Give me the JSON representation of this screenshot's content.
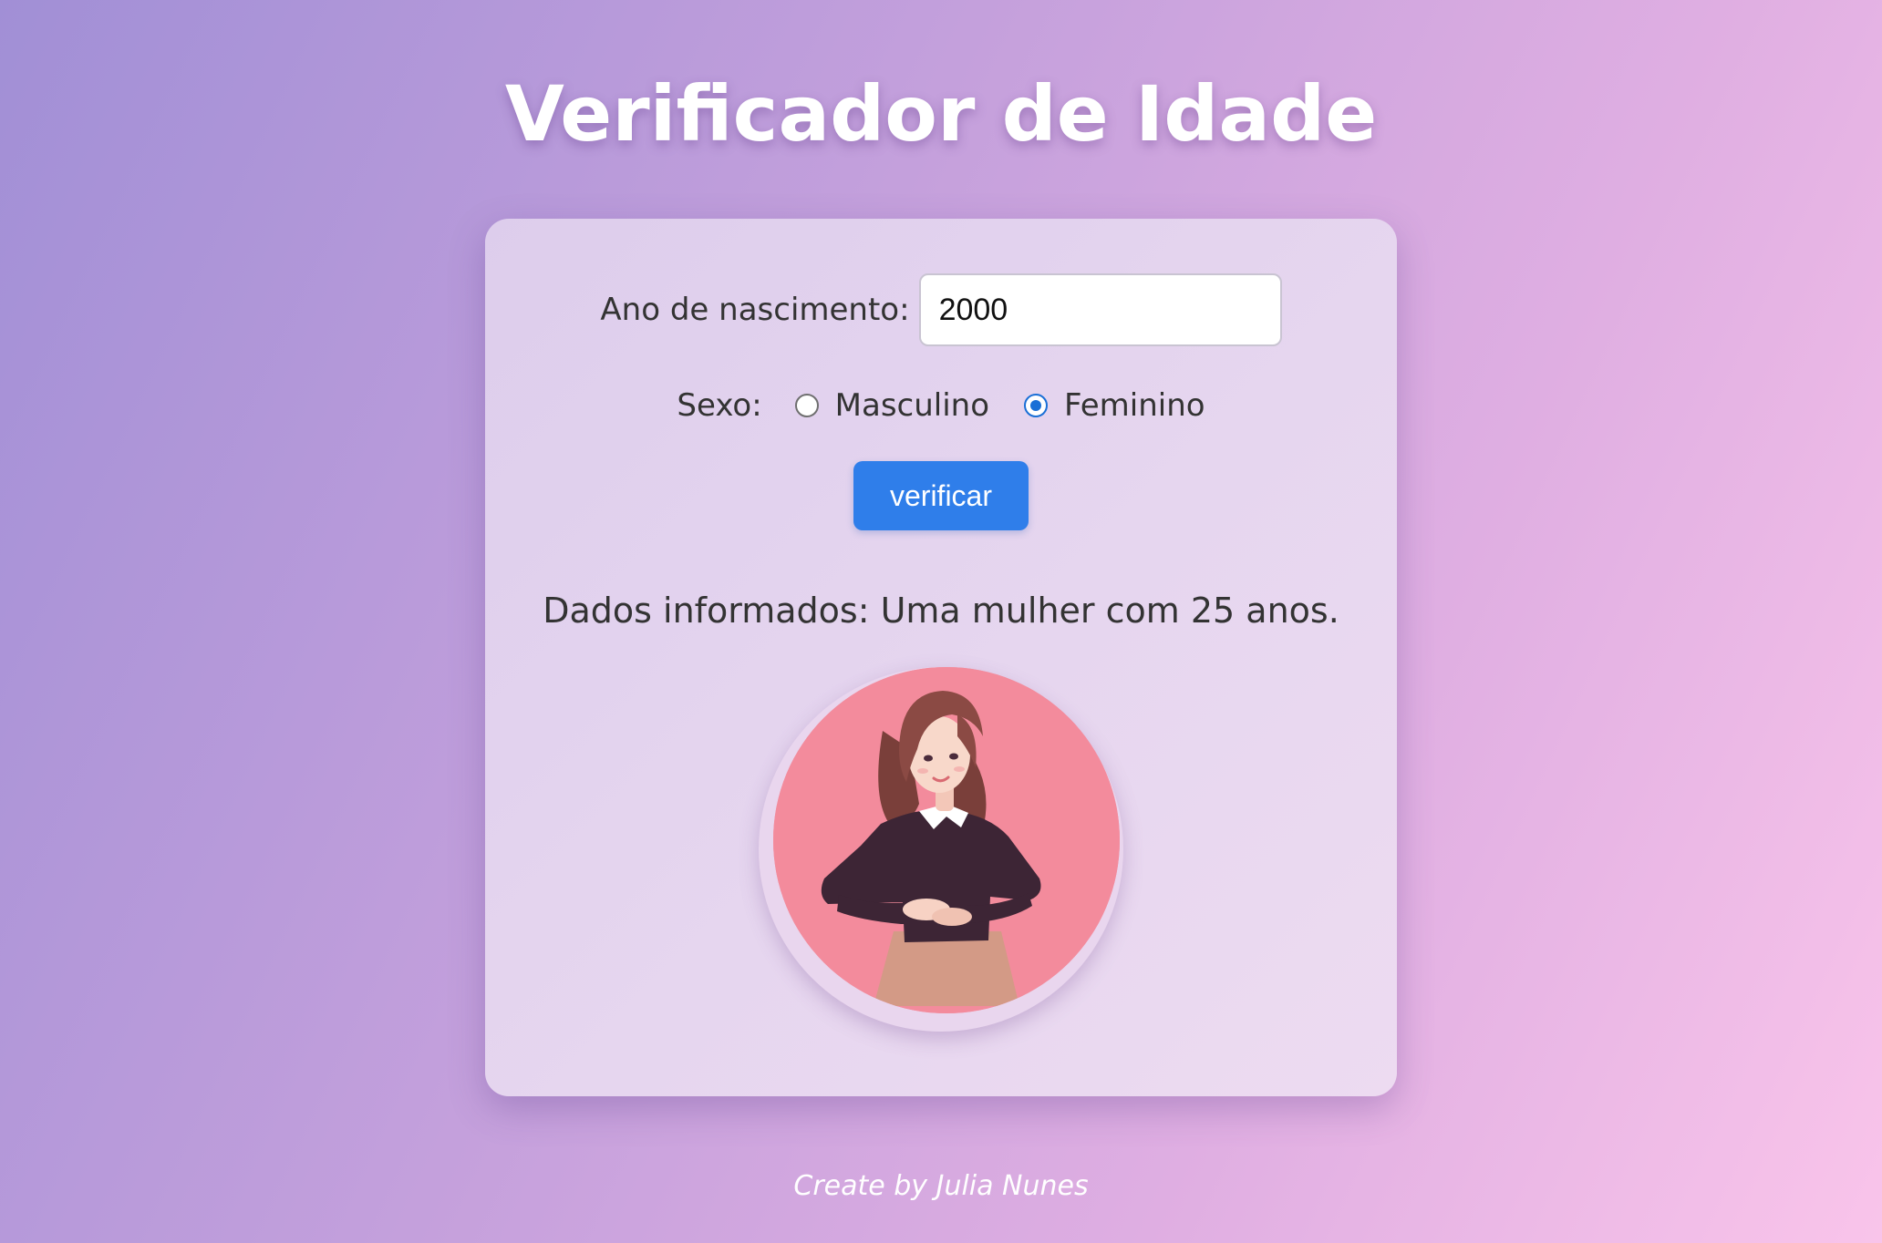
{
  "page": {
    "title": "Verificador de Idade",
    "footer": "Create by Julia Nunes"
  },
  "form": {
    "year_label": "Ano de nascimento:",
    "year_value": "2000",
    "sex_label": "Sexo:",
    "sex_options": [
      {
        "label": "Masculino",
        "checked": false
      },
      {
        "label": "Feminino",
        "checked": true
      }
    ],
    "submit_label": "verificar"
  },
  "result": {
    "text": "Dados informados: Uma mulher com 25 anos.",
    "avatar_icon": "woman-avatar-icon"
  },
  "colors": {
    "button": "#2f7eea",
    "radio_selected": "#1a6fd6",
    "avatar_bg": "#f38b9c"
  }
}
